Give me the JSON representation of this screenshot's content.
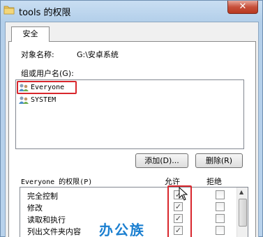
{
  "window": {
    "title": "tools 的权限",
    "close_label": "✕",
    "folder_icon": "folder-icon",
    "titlebar_color": "#b3cfea"
  },
  "tabs": [
    {
      "label": "安全"
    }
  ],
  "object_name": {
    "label": "对象名称:",
    "value": "G:\\安卓系统"
  },
  "groups": {
    "label": "组或用户名(G):",
    "items": [
      {
        "name": "Everyone",
        "icon": "users-icon",
        "selected": true
      },
      {
        "name": "SYSTEM",
        "icon": "users-icon",
        "selected": false
      }
    ]
  },
  "buttons": {
    "add": "添加(D)...",
    "remove": "删除(R)"
  },
  "permissions": {
    "header": "Everyone 的权限(P)",
    "allow_label": "允许",
    "deny_label": "拒绝",
    "rows": [
      {
        "name": "完全控制",
        "allow": true,
        "deny": false
      },
      {
        "name": "修改",
        "allow": true,
        "deny": false
      },
      {
        "name": "读取和执行",
        "allow": true,
        "deny": false
      },
      {
        "name": "列出文件夹内容",
        "allow": true,
        "deny": false
      }
    ]
  },
  "watermark": "办公族",
  "accent_color": "#d8262c"
}
